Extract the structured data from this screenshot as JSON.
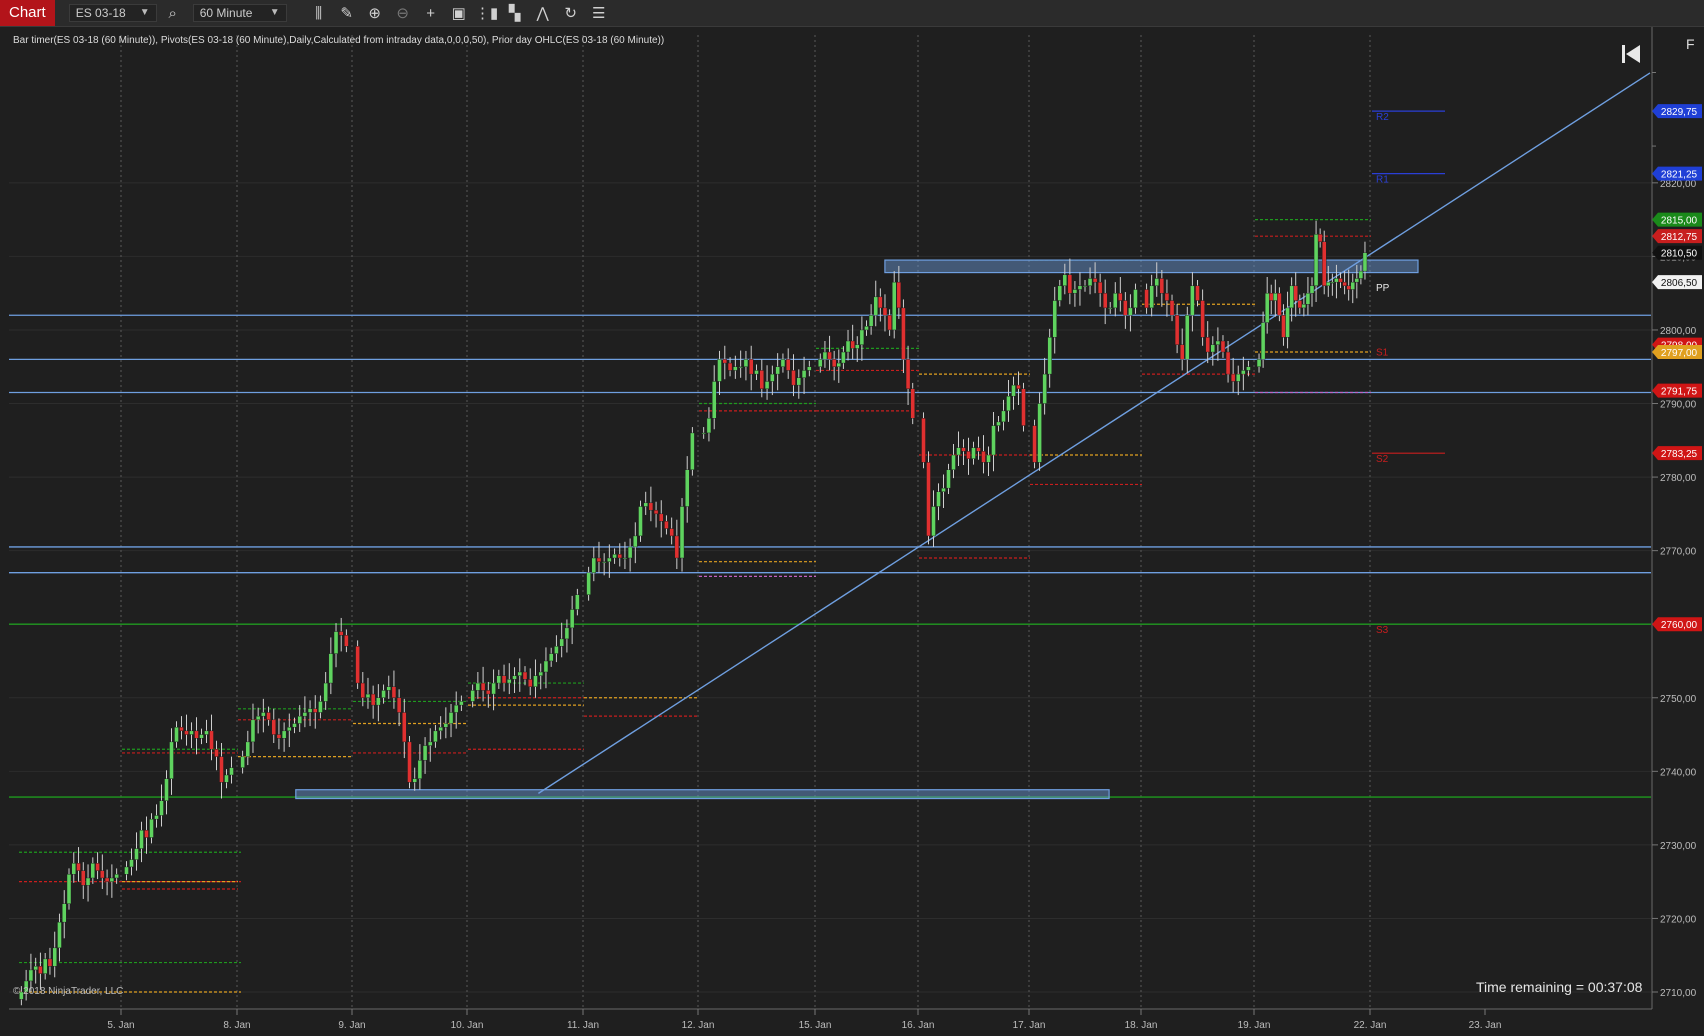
{
  "toolbar": {
    "tab_label": "Chart",
    "instrument": "ES 03-18",
    "interval": "60 Minute",
    "icons": [
      "bars-type-icon",
      "draw-pencil-icon",
      "zoom-in-icon",
      "zoom-out-icon",
      "crosshair-icon",
      "properties-icon",
      "strategies-icon",
      "indicators-icon",
      "drawing-tools-icon",
      "refresh-icon",
      "list-icon"
    ]
  },
  "indicator_label": "Bar timer(ES 03-18 (60 Minute)), Pivots(ES 03-18 (60 Minute),Daily,Calculated from intraday data,0,0,0,50), Prior day OHLC(ES 03-18 (60 Minute))",
  "time_remaining": "Time remaining = 00:37:08",
  "copyright": "© 2018 NinjaTrader, LLC",
  "f_label": "F",
  "colors": {
    "background": "#1f1f1f",
    "up_candle": "#5fd35f",
    "down_candle": "#e03030",
    "line": "#6f9fe0",
    "green_line": "#1f9a1f"
  },
  "chart_data": {
    "type": "candlestick",
    "instrument": "ES 03-18",
    "ylim": [
      2709,
      2840
    ],
    "y_ticks": [
      "2710,00",
      "2720,00",
      "2730,00",
      "2740,00",
      "2750,00",
      "2760,00",
      "2770,00",
      "2780,00",
      "2790,00",
      "2800,00",
      "2810,00",
      "2820,00"
    ],
    "x_ticks": [
      "5. Jan",
      "8. Jan",
      "9. Jan",
      "10. Jan",
      "11. Jan",
      "12. Jan",
      "15. Jan",
      "16. Jan",
      "17. Jan",
      "18. Jan",
      "19. Jan",
      "22. Jan",
      "23. Jan"
    ],
    "price_markers": [
      {
        "value": 2829.75,
        "label": "2829,75",
        "color": "#1f3fd6"
      },
      {
        "value": 2821.25,
        "label": "2821,25",
        "color": "#1f3fd6"
      },
      {
        "value": 2815.0,
        "label": "2815,00",
        "color": "#1a8a1a"
      },
      {
        "value": 2812.75,
        "label": "2812,75",
        "color": "#c81e1e"
      },
      {
        "value": 2810.5,
        "label": "2810,50",
        "color": "#111111"
      },
      {
        "value": 2806.5,
        "label": "2806,50",
        "color": "#f2f2f2"
      },
      {
        "value": 2798.0,
        "label": "2798,00",
        "color": "#d01515"
      },
      {
        "value": 2797.0,
        "label": "2797,00",
        "color": "#e0a020"
      },
      {
        "value": 2791.75,
        "label": "2791,75",
        "color": "#d01515"
      },
      {
        "value": 2783.25,
        "label": "2783,25",
        "color": "#d01515"
      },
      {
        "value": 2760.0,
        "label": "2760,00",
        "color": "#d01515"
      }
    ],
    "pivot_labels": [
      {
        "text": "R2",
        "value": 2829.75
      },
      {
        "text": "R1",
        "value": 2821.25
      },
      {
        "text": "PP",
        "value": 2806.5
      },
      {
        "text": "S1",
        "value": 2797.75
      },
      {
        "text": "S2",
        "value": 2783.25
      },
      {
        "text": "S3",
        "value": 2760.0
      }
    ],
    "horizontal_lines": [
      {
        "value": 2802.0,
        "color": "#6f9fe0"
      },
      {
        "value": 2796.0,
        "color": "#6f9fe0"
      },
      {
        "value": 2791.5,
        "color": "#6f9fe0"
      },
      {
        "value": 2770.5,
        "color": "#6f9fe0"
      },
      {
        "value": 2767.0,
        "color": "#6f9fe0"
      },
      {
        "value": 2760.0,
        "color": "#1f9a1f"
      },
      {
        "value": 2736.5,
        "color": "#1f9a1f"
      }
    ],
    "day_levels": [
      {
        "day": "5. Jan",
        "lines": [
          {
            "v": 2729,
            "c": "#1f9a1f"
          },
          {
            "v": 2725,
            "c": "#c81e1e"
          },
          {
            "v": 2714,
            "c": "#1f9a1f"
          },
          {
            "v": 2710,
            "c": "#e0a020"
          }
        ]
      },
      {
        "day": "8. Jan",
        "lines": [
          {
            "v": 2743,
            "c": "#1f9a1f"
          },
          {
            "v": 2742.5,
            "c": "#c81e1e"
          },
          {
            "v": 2725,
            "c": "#e0a020"
          },
          {
            "v": 2724,
            "c": "#c81e1e"
          }
        ]
      },
      {
        "day": "9. Jan",
        "lines": [
          {
            "v": 2748.5,
            "c": "#1f9a1f"
          },
          {
            "v": 2747,
            "c": "#c81e1e"
          },
          {
            "v": 2742,
            "c": "#e0a020"
          }
        ]
      },
      {
        "day": "10. Jan",
        "lines": [
          {
            "v": 2749.5,
            "c": "#1f9a1f"
          },
          {
            "v": 2746.5,
            "c": "#e0a020"
          },
          {
            "v": 2742.5,
            "c": "#c81e1e"
          }
        ]
      },
      {
        "day": "11. Jan",
        "lines": [
          {
            "v": 2752,
            "c": "#1f9a1f"
          },
          {
            "v": 2750,
            "c": "#c81e1e"
          },
          {
            "v": 2749,
            "c": "#e0a020"
          },
          {
            "v": 2743,
            "c": "#c81e1e"
          }
        ]
      },
      {
        "day": "12. Jan",
        "lines": [
          {
            "v": 2750,
            "c": "#e0a020"
          },
          {
            "v": 2747.5,
            "c": "#c81e1e"
          }
        ]
      },
      {
        "day": "15. Jan",
        "lines": [
          {
            "v": 2790,
            "c": "#1f9a1f"
          },
          {
            "v": 2789,
            "c": "#c81e1e"
          },
          {
            "v": 2768.5,
            "c": "#e0a020"
          },
          {
            "v": 2766.5,
            "c": "#c060c0"
          }
        ]
      },
      {
        "day": "16. Jan",
        "lines": [
          {
            "v": 2797.5,
            "c": "#1f9a1f"
          },
          {
            "v": 2794.5,
            "c": "#c81e1e"
          },
          {
            "v": 2789,
            "c": "#c81e1e"
          }
        ]
      },
      {
        "day": "17. Jan",
        "lines": [
          {
            "v": 2794,
            "c": "#e0a020"
          },
          {
            "v": 2783,
            "c": "#c81e1e"
          },
          {
            "v": 2769,
            "c": "#c81e1e"
          }
        ]
      },
      {
        "day": "18. Jan",
        "lines": [
          {
            "v": 2809.5,
            "c": "#1f9a1f"
          },
          {
            "v": 2783,
            "c": "#e0a020"
          },
          {
            "v": 2779,
            "c": "#c81e1e"
          }
        ]
      },
      {
        "day": "19. Jan",
        "lines": [
          {
            "v": 2803.5,
            "c": "#e0a020"
          },
          {
            "v": 2794,
            "c": "#c81e1e"
          }
        ]
      },
      {
        "day": "22. Jan",
        "lines": [
          {
            "v": 2815,
            "c": "#1f9a1f"
          },
          {
            "v": 2812.75,
            "c": "#c81e1e"
          },
          {
            "v": 2797,
            "c": "#e0a020"
          },
          {
            "v": 2791.5,
            "c": "#c060c0"
          }
        ]
      }
    ],
    "trendline": {
      "start": {
        "day_pos": 4.65,
        "value": 2737
      },
      "end": {
        "day_pos": 12.4,
        "value": 2814.5
      },
      "color": "#6f9fe0"
    },
    "rectangles": [
      {
        "start_day_pos": 2.55,
        "end_day_pos": 9.7,
        "top": 2737.5,
        "bottom": 2736.3
      },
      {
        "start_day_pos": 7.7,
        "end_day_pos": 12.4,
        "top": 2809.5,
        "bottom": 2807.8
      }
    ],
    "closes": {
      "5. Jan": [
        2710,
        2711.5,
        2713,
        2713.5,
        2712.5,
        2714.5,
        2713.5,
        2716,
        2719.5,
        2722,
        2726,
        2727.5,
        2726.5,
        2724.5,
        2725.5,
        2727.5,
        2726.5,
        2725.5,
        2725,
        2725.5,
        2726
      ],
      "8. Jan": [
        2727,
        2728,
        2729.5,
        2732,
        2731,
        2733.5,
        2734,
        2736,
        2739,
        2744,
        2746,
        2745.5,
        2745,
        2745.5,
        2744.5,
        2745,
        2745.5,
        2743,
        2742,
        2738.5,
        2739.5,
        2740.5
      ],
      "9. Jan": [
        2742,
        2744,
        2747,
        2747.5,
        2748,
        2747,
        2745,
        2744.5,
        2745.5,
        2746,
        2746.5,
        2747.5,
        2748,
        2748.5,
        2748,
        2749.5,
        2752,
        2756,
        2759,
        2758.5,
        2757
      ],
      "10. Jan": [
        2752,
        2750,
        2750.5,
        2749,
        2750,
        2751,
        2751.5,
        2750,
        2748,
        2744,
        2738.5,
        2739,
        2741.5,
        2743.5,
        2744,
        2745.5,
        2746,
        2746.5,
        2748,
        2749,
        2749.5
      ],
      "11. Jan": [
        2751,
        2752,
        2751,
        2750.5,
        2752,
        2753,
        2752,
        2752.5,
        2753,
        2753.5,
        2752.5,
        2751.5,
        2753,
        2753.5,
        2755,
        2756,
        2757,
        2758,
        2759.5,
        2762,
        2764
      ],
      "12. Jan": [
        2767,
        2769,
        2768.5,
        2768.5,
        2769,
        2769.5,
        2769,
        2769,
        2770.5,
        2772,
        2776,
        2776.5,
        2775.5,
        2775,
        2774,
        2773,
        2772,
        2769,
        2776,
        2781,
        2786
      ],
      "15. Jan": [
        2786,
        2788,
        2793,
        2796,
        2795.5,
        2794.5,
        2795,
        2795,
        2796,
        2794,
        2794.5,
        2792,
        2793,
        2794,
        2795,
        2796,
        2794.5,
        2792.5,
        2793.5,
        2794.5,
        2795
      ],
      "16. Jan": [
        2796,
        2797,
        2796,
        2795,
        2795.5,
        2797,
        2798.5,
        2797.5,
        2798,
        2800,
        2800.5,
        2802,
        2804.5,
        2803,
        2802,
        2800,
        2806.5,
        2803,
        2796,
        2792,
        2788
      ],
      "17. Jan": [
        2782,
        2772,
        2776,
        2778,
        2778.5,
        2781,
        2783,
        2784,
        2783.5,
        2782.5,
        2784,
        2783.5,
        2782,
        2783,
        2787,
        2787.5,
        2789,
        2791,
        2792.5,
        2792,
        2787
      ],
      "18. Jan": [
        2782,
        2790,
        2794,
        2799,
        2804,
        2806,
        2807.5,
        2805,
        2805.5,
        2806,
        2806,
        2807,
        2806.5,
        2805,
        2803,
        2803,
        2805,
        2804,
        2802,
        2803,
        2805.5
      ],
      "19. Jan": [
        2803,
        2806,
        2807,
        2805,
        2804,
        2802,
        2798,
        2796,
        2802,
        2806,
        2804,
        2799,
        2797,
        2798,
        2798.5,
        2797,
        2794,
        2793,
        2794,
        2794.5,
        2795
      ],
      "22. Jan": [
        2796,
        2801,
        2805,
        2804,
        2805,
        2802,
        2799,
        2803,
        2806,
        2804,
        2803,
        2803.5,
        2805,
        2806,
        2813,
        2812,
        2806,
        2806.5,
        2806.5,
        2807,
        2806.5,
        2806,
        2805.5,
        2806.5,
        2807,
        2808,
        2810.5
      ]
    }
  }
}
